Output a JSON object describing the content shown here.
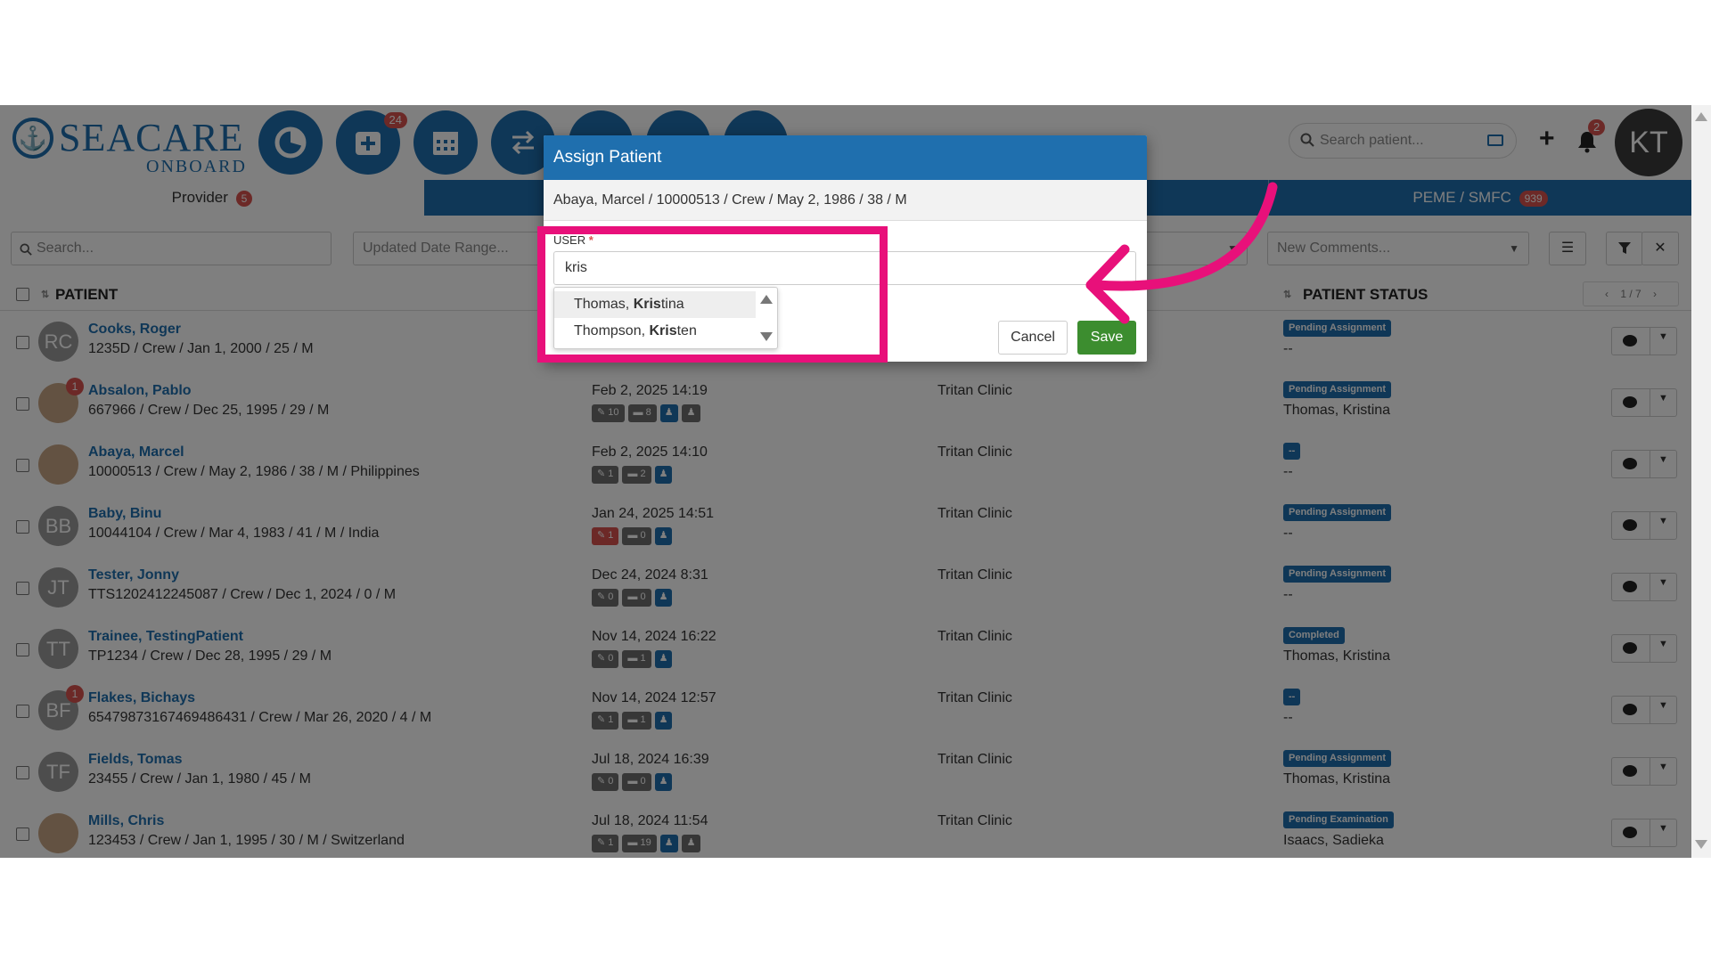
{
  "app": {
    "logo": {
      "name": "SEACARE",
      "sub": "ONBOARD"
    },
    "nav_badge": "24",
    "search_placeholder": "Search patient...",
    "notif_count": "2",
    "user_initials": "KT"
  },
  "tabs": {
    "provider_label": "Provider",
    "provider_count": "5",
    "peme_label": "PEME / SMFC",
    "peme_count": "939"
  },
  "filters": {
    "search_placeholder": "Search...",
    "date_range_placeholder": "Updated Date Range...",
    "new_comments_placeholder": "New Comments..."
  },
  "table": {
    "col_patient": "PATIENT",
    "col_status": "PATIENT STATUS",
    "pager": "1 / 7",
    "rows": [
      {
        "initials": "RC",
        "name": "Cooks, Roger",
        "details": "1235D / Crew / Jan 1, 2000 / 25 / M",
        "date": "",
        "clinic": "",
        "status": "Pending Assignment",
        "assignee": "--",
        "badge": "",
        "pills": []
      },
      {
        "initials": "",
        "name": "Absalon, Pablo",
        "details": "667966 / Crew / Dec 25, 1995 / 29 / M",
        "date": "Feb 2, 2025 14:19",
        "clinic": "Tritan Clinic",
        "status": "Pending Assignment",
        "assignee": "Thomas, Kristina",
        "badge": "1",
        "pills": [
          "10",
          "8"
        ]
      },
      {
        "initials": "",
        "name": "Abaya, Marcel",
        "details": "10000513 / Crew / May 2, 1986 / 38 / M / Philippines",
        "date": "Feb 2, 2025 14:10",
        "clinic": "Tritan Clinic",
        "status": "--",
        "assignee": "--",
        "badge": "",
        "pills": [
          "1",
          "2"
        ]
      },
      {
        "initials": "BB",
        "name": "Baby, Binu",
        "details": "10044104 / Crew / Mar 4, 1983 / 41 / M / India",
        "date": "Jan 24, 2025 14:51",
        "clinic": "Tritan Clinic",
        "status": "Pending Assignment",
        "assignee": "--",
        "badge": "",
        "pills": [
          "1",
          "0"
        ]
      },
      {
        "initials": "JT",
        "name": "Tester, Jonny",
        "details": "TTS1202412245087 / Crew / Dec 1, 2024 / 0 / M",
        "date": "Dec 24, 2024 8:31",
        "clinic": "Tritan Clinic",
        "status": "Pending Assignment",
        "assignee": "--",
        "badge": "",
        "pills": [
          "0",
          "0"
        ]
      },
      {
        "initials": "TT",
        "name": "Trainee, TestingPatient",
        "details": "TP1234 / Crew / Dec 28, 1995 / 29 / M",
        "date": "Nov 14, 2024 16:22",
        "clinic": "Tritan Clinic",
        "status": "Completed",
        "assignee": "Thomas, Kristina",
        "badge": "",
        "pills": [
          "0",
          "1"
        ]
      },
      {
        "initials": "BF",
        "name": "Flakes, Bichays",
        "details": "65479873167469486431 / Crew / Mar 26, 2020 / 4 / M",
        "date": "Nov 14, 2024 12:57",
        "clinic": "Tritan Clinic",
        "status": "--",
        "assignee": "--",
        "badge": "1",
        "pills": [
          "1",
          "1"
        ]
      },
      {
        "initials": "TF",
        "name": "Fields, Tomas",
        "details": "23455 / Crew / Jan 1, 1980 / 45 / M",
        "date": "Jul 18, 2024 16:39",
        "clinic": "Tritan Clinic",
        "status": "Pending Assignment",
        "assignee": "Thomas, Kristina",
        "badge": "",
        "pills": [
          "0",
          "0"
        ]
      },
      {
        "initials": "",
        "name": "Mills, Chris",
        "details": "123453 / Crew / Jan 1, 1995 / 30 / M / Switzerland",
        "date": "Jul 18, 2024 11:54",
        "clinic": "Tritan Clinic",
        "status": "Pending Examination",
        "assignee": "Isaacs, Sadieka",
        "badge": "",
        "pills": [
          "1",
          "19"
        ]
      }
    ]
  },
  "modal": {
    "title": "Assign Patient",
    "patient_info": "Abaya, Marcel / 10000513 / Crew / May 2, 1986 / 38 / M",
    "user_label": "USER",
    "required_mark": "*",
    "user_value": "kris",
    "options": [
      {
        "pre": "Thomas, ",
        "match": "Kris",
        "post": "tina"
      },
      {
        "pre": "Thompson, ",
        "match": "Kris",
        "post": "ten"
      }
    ],
    "cancel_label": "Cancel",
    "save_label": "Save"
  },
  "colors": {
    "brand": "#1f6fae",
    "highlight": "#e8107a",
    "save": "#3c8d2f",
    "badge": "#d9534f"
  },
  "icons": [
    "dashboard-icon",
    "add-medical-icon",
    "calendar-icon",
    "transfer-icon",
    "search-icon",
    "card-icon",
    "plus-icon",
    "bell-icon",
    "filter-icon",
    "clear-icon",
    "settings-sliders-icon",
    "comment-icon"
  ]
}
